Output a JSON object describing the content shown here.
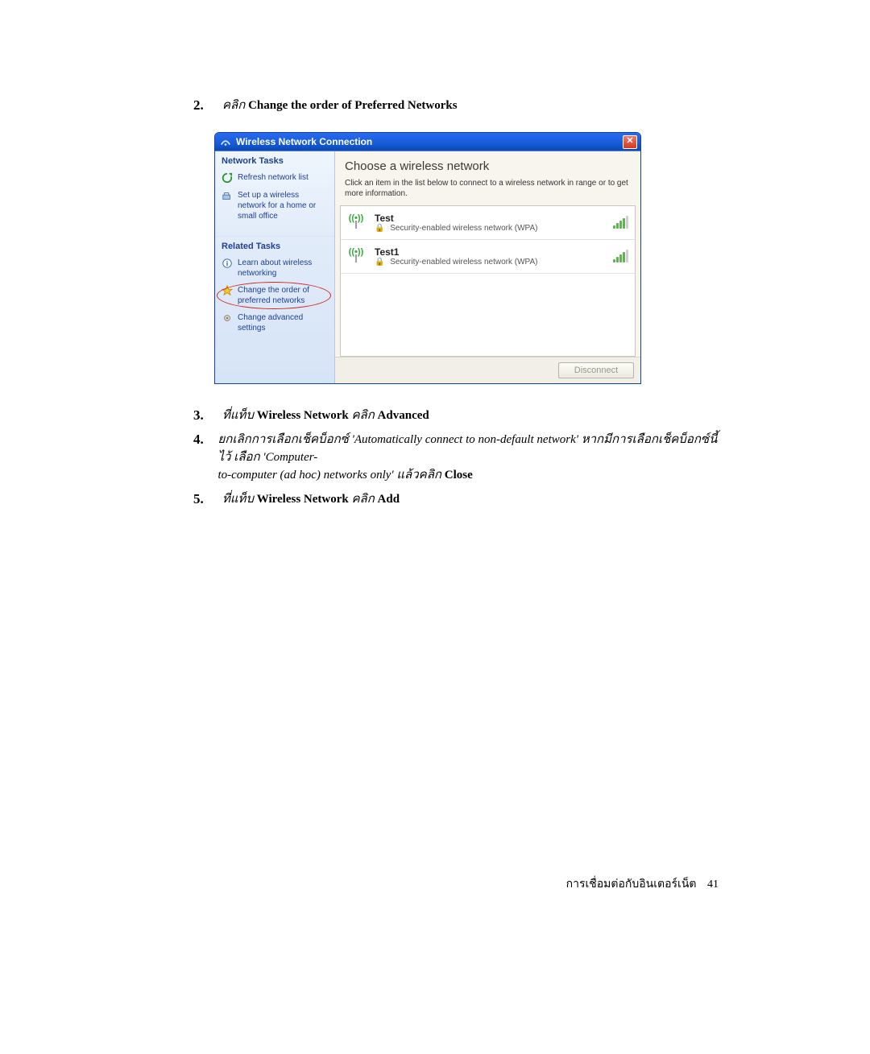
{
  "steps": {
    "s2": {
      "num": "2.",
      "pre": "คลิก ",
      "bold": "Change the order of Preferred Networks"
    },
    "s3": {
      "num": "3.",
      "t1": "ที่แท็บ ",
      "b1": "Wireless Network ",
      "t2": "คลิก ",
      "b2": "Advanced"
    },
    "s4": {
      "num": "4.",
      "line1a": "ยกเลิกการเลือกเช็คบ็อกซ์ '",
      "line1b": "Automatically connect to non-default network",
      "line1c": "' หากมีการเลือกเช็คบ็อกซ์นี้ไว้ เลือก '",
      "line1d": "Computer-",
      "line2a": "to-computer (ad hoc) networks only",
      "line2b": "' แล้วคลิก ",
      "line2c": "Close"
    },
    "s5": {
      "num": "5.",
      "t1": "ที่แท็บ ",
      "b1": "Wireless Network ",
      "t2": "คลิก ",
      "b2": "Add"
    }
  },
  "window": {
    "title": "Wireless Network Connection",
    "close": "✕",
    "left": {
      "tasks_head": "Network Tasks",
      "refresh": "Refresh network list",
      "setup": "Set up a wireless network for a home or small office",
      "related_head": "Related Tasks",
      "learn": "Learn about wireless networking",
      "change_order": "Change the order of preferred networks",
      "advanced": "Change advanced settings"
    },
    "right": {
      "heading": "Choose a wireless network",
      "sub": "Click an item in the list below to connect to a wireless network in range or to get more information.",
      "security_label": "Security-enabled wireless network (WPA)",
      "networks": [
        {
          "name": "Test",
          "signal": 4
        },
        {
          "name": "Test1",
          "signal": 4
        }
      ],
      "disconnect": "Disconnect"
    }
  },
  "footer": {
    "text": "การเชื่อมต่อกับอินเตอร์เน็ต",
    "page": "41"
  }
}
